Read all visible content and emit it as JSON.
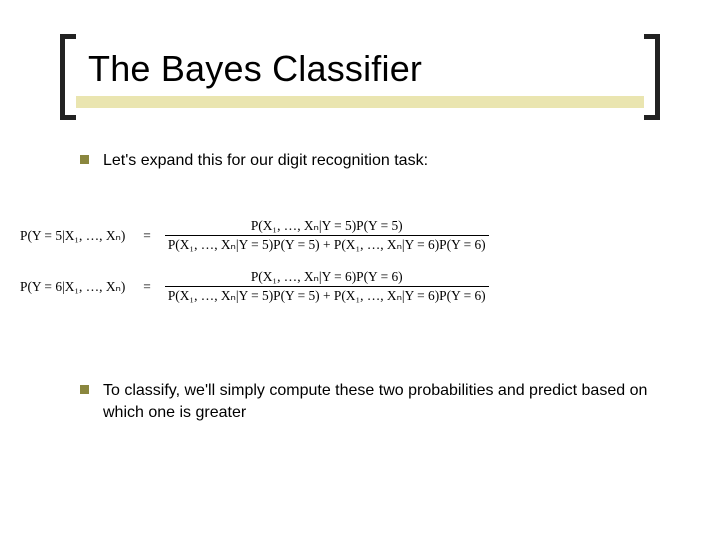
{
  "title": "The Bayes Classifier",
  "bullets": {
    "b1": "Let's expand this for our digit recognition task:",
    "b2": "To classify, we'll simply compute these two probabilities and predict based on which one is greater"
  },
  "eq": {
    "lhs1": "P(Y = 5|X₁, …, Xₙ)",
    "num1": "P(X₁, …, Xₙ|Y = 5)P(Y = 5)",
    "den1": "P(X₁, …, Xₙ|Y = 5)P(Y = 5) + P(X₁, …, Xₙ|Y = 6)P(Y = 6)",
    "lhs2": "P(Y = 6|X₁, …, Xₙ)",
    "num2": "P(X₁, …, Xₙ|Y = 6)P(Y = 6)",
    "den2": "P(X₁, …, Xₙ|Y = 5)P(Y = 5) + P(X₁, …, Xₙ|Y = 6)P(Y = 6)",
    "equals": "="
  }
}
